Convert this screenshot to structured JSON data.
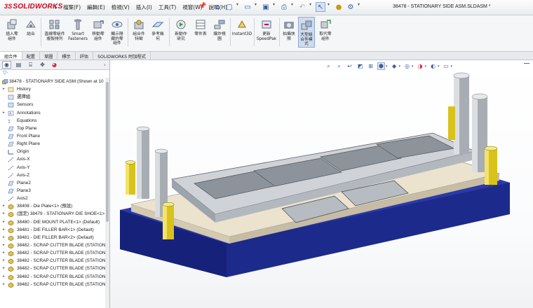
{
  "app": {
    "logo_ds": "3S",
    "logo_text": "SOLIDWORKS",
    "doc_title": "38478 - STATIONARY SIDE ASM.SLDASM *"
  },
  "menu": [
    "檔案(F)",
    "編輯(E)",
    "檢視(V)",
    "插入(I)",
    "工具(T)",
    "視窗(W)",
    "說明(H)"
  ],
  "quick_access": [
    "home-icon",
    "new-icon",
    "open-icon",
    "save-icon",
    "print-icon",
    "undo-icon",
    "select-icon",
    "rebuild-icon",
    "options-icon"
  ],
  "ribbon": {
    "buttons": [
      {
        "id": "insert-components",
        "label": "插入零\n組件"
      },
      {
        "id": "mate",
        "label": "結合"
      },
      {
        "id": "linear-pattern",
        "label": "直線零組件\n複製排列"
      },
      {
        "id": "smart-fasteners",
        "label": "Smart\nFasteners"
      },
      {
        "id": "move-component",
        "label": "移動零\n組件"
      },
      {
        "id": "show-hidden",
        "label": "顯示隱\n藏的零\n組件"
      },
      {
        "id": "assembly-features",
        "label": "組合件\n特徵"
      },
      {
        "id": "reference-geometry",
        "label": "參考幾\n何"
      },
      {
        "id": "new-motion-study",
        "label": "新動作\n研究"
      },
      {
        "id": "bom",
        "label": "零件表"
      },
      {
        "id": "exploded-view",
        "label": "爆炸視\n圖"
      },
      {
        "id": "instant3d",
        "label": "Instant3D"
      },
      {
        "id": "speedpak",
        "label": "更新\nSpeedPak"
      },
      {
        "id": "snapshot",
        "label": "拍攝快\n照"
      },
      {
        "id": "large-assembly",
        "label": "大型組\n合件模\n式"
      },
      {
        "id": "replace-component",
        "label": "取代零\n組件"
      }
    ]
  },
  "cm_tabs": [
    "組合件",
    "配置",
    "草圖",
    "標示",
    "評估",
    "SOLIDWORKS 附加程式"
  ],
  "feature_tree": {
    "root": "38478 - STATIONARY SIDE ASM  (Shown at 10",
    "nodes": [
      {
        "label": "History",
        "icon": "history-icon",
        "twisty": "▸"
      },
      {
        "label": "選擇組",
        "icon": "selection-set-icon",
        "twisty": ""
      },
      {
        "label": "Sensors",
        "icon": "sensor-icon",
        "twisty": ""
      },
      {
        "label": "Annotations",
        "icon": "annotation-icon",
        "twisty": "▸"
      },
      {
        "label": "Equations",
        "icon": "equation-icon",
        "twisty": ""
      },
      {
        "label": "Top Plane",
        "icon": "plane-icon",
        "twisty": ""
      },
      {
        "label": "Front Plane",
        "icon": "plane-icon",
        "twisty": ""
      },
      {
        "label": "Right Plane",
        "icon": "plane-icon",
        "twisty": ""
      },
      {
        "label": "Origin",
        "icon": "origin-icon",
        "twisty": ""
      },
      {
        "label": "Axis-X",
        "icon": "axis-icon",
        "twisty": ""
      },
      {
        "label": "Axis-Y",
        "icon": "axis-icon",
        "twisty": ""
      },
      {
        "label": "Axis-Z",
        "icon": "axis-icon",
        "twisty": ""
      },
      {
        "label": "Plane2",
        "icon": "plane-icon",
        "twisty": ""
      },
      {
        "label": "Plane3",
        "icon": "plane-icon",
        "twisty": ""
      },
      {
        "label": "Axis2",
        "icon": "axis-icon",
        "twisty": ""
      },
      {
        "label": "38408 - Die Plate<1> (預設)",
        "icon": "part-icon",
        "twisty": "▸"
      },
      {
        "label": "(固定) 38479 - STATIONARY DIE SHOE<1>",
        "icon": "part-icon",
        "twisty": "▸"
      },
      {
        "label": "38480 - DIE MOUNT PLATE<1> (Default)",
        "icon": "part-icon",
        "twisty": "▸"
      },
      {
        "label": "38481 - DIE FILLER BAR<1> (Default)",
        "icon": "part-icon",
        "twisty": "▸"
      },
      {
        "label": "38481 - DIE FILLER BAR<2> (Default)",
        "icon": "part-icon",
        "twisty": "▸"
      },
      {
        "label": "38482 - SCRAP CUTTER BLADE (STATIONA",
        "icon": "part-icon",
        "twisty": "▸"
      },
      {
        "label": "38482 - SCRAP CUTTER BLADE (STATIONA",
        "icon": "part-icon",
        "twisty": "▸"
      },
      {
        "label": "38482 - SCRAP CUTTER BLADE (STATIONA",
        "icon": "part-icon",
        "twisty": "▸"
      },
      {
        "label": "38482 - SCRAP CUTTER BLADE (STATIONA",
        "icon": "part-icon",
        "twisty": "▸"
      },
      {
        "label": "38482 - SCRAP CUTTER BLADE (STATIONA",
        "icon": "part-icon",
        "twisty": "▸"
      },
      {
        "label": "38482 - SCRAP CUTTER BLADE (STATIONA",
        "icon": "part-icon",
        "twisty": "▸"
      }
    ]
  },
  "heads_up_toolbar": [
    "zoom-to-fit-icon",
    "zoom-area-icon",
    "previous-view-icon",
    "section-view-icon",
    "dynamic-annotation-icon",
    "view-orientation-icon",
    "display-style-icon",
    "hide-show-icon",
    "edit-appearance-icon",
    "scene-icon",
    "view-settings-icon"
  ],
  "colors": {
    "logo_red": "#d0021b",
    "base_blue": "#1c2a8c",
    "plate_beige": "#e8ddc8",
    "steel": "#b9bec4",
    "bushing_yellow": "#d9c21a",
    "accent": "#2a6bd1"
  }
}
